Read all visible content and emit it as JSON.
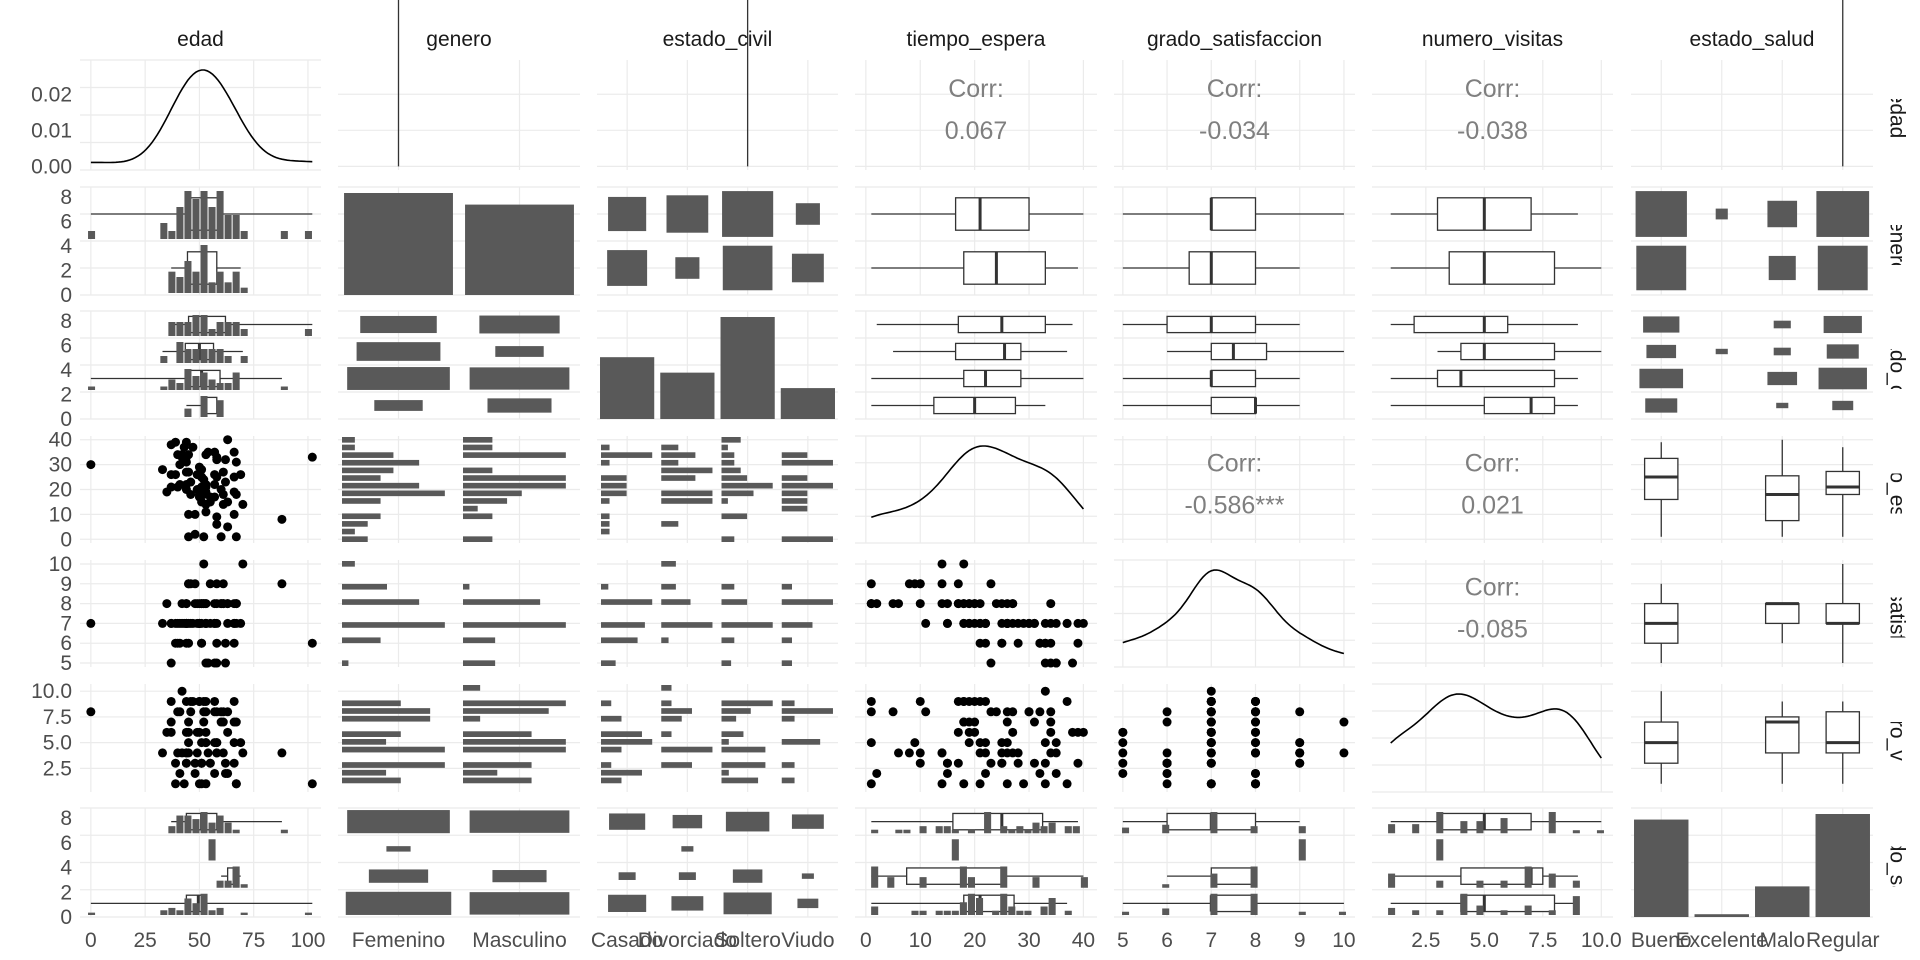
{
  "chart_data": {
    "type": "scatter-matrix",
    "variables": [
      "edad",
      "genero",
      "estado_civil",
      "tiempo_espera",
      "grado_satisfaccion",
      "numero_visitas",
      "estado_salud"
    ],
    "strip_labels_right": [
      "edad",
      "genero",
      "estado_civil",
      "tiempo_espera",
      "grado_satisfaccion",
      "numero_visitas",
      "estado_salud"
    ],
    "x_ticks": {
      "edad": [
        "0",
        "25",
        "50",
        "75",
        "100"
      ],
      "genero": [
        "Femenino",
        "Masculino"
      ],
      "estado_civil": [
        "Casado",
        "Divorciado",
        "Soltero",
        "Viudo"
      ],
      "tiempo_espera": [
        "0",
        "10",
        "20",
        "30",
        "40"
      ],
      "grado_satisfaccion": [
        "5",
        "6",
        "7",
        "8",
        "9",
        "10"
      ],
      "numero_visitas": [
        "2.5",
        "5.0",
        "7.5",
        "10.0"
      ],
      "estado_salud": [
        "Bueno",
        "Excelente",
        "Malo",
        "Regular"
      ]
    },
    "y_ticks": {
      "edad": [
        "0.00",
        "0.01",
        "0.02"
      ],
      "genero": [
        "0",
        "2",
        "4",
        "6",
        "8"
      ],
      "estado_civil": [
        "0",
        "2",
        "4",
        "6",
        "8"
      ],
      "tiempo_espera": [
        "0",
        "10",
        "20",
        "30",
        "40"
      ],
      "grado_satisfaccion": [
        "5",
        "6",
        "7",
        "8",
        "9",
        "10"
      ],
      "numero_visitas": [
        "2.5",
        "5.0",
        "7.5",
        "10.0"
      ],
      "estado_salud": [
        "0",
        "2",
        "4",
        "6",
        "8"
      ]
    },
    "correlations": [
      {
        "row": 0,
        "col": 3,
        "label": "Corr:",
        "value": "0.067"
      },
      {
        "row": 0,
        "col": 4,
        "label": "Corr:",
        "value": "-0.034"
      },
      {
        "row": 0,
        "col": 5,
        "label": "Corr:",
        "value": "-0.038"
      },
      {
        "row": 3,
        "col": 4,
        "label": "Corr:",
        "value": "-0.586***"
      },
      {
        "row": 3,
        "col": 5,
        "label": "Corr:",
        "value": "0.021"
      },
      {
        "row": 4,
        "col": 5,
        "label": "Corr:",
        "value": "-0.085"
      }
    ],
    "counts": {
      "genero": [
        44,
        39
      ],
      "estado_civil": [
        20,
        15,
        33,
        10
      ],
      "estado_salud": [
        35,
        1,
        11,
        37
      ]
    },
    "grid": true,
    "colors": {
      "marks": "#595959",
      "points": "#000000",
      "grid": "#ebebeb",
      "corr_text": "#7f7f7f",
      "axis_text": "#4d4d4d",
      "strip_text": "#1a1a1a"
    }
  }
}
